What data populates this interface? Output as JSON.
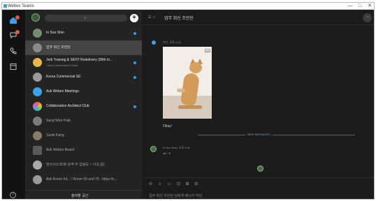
{
  "window": {
    "title": "Webex Teams",
    "controls": [
      "—",
      "□",
      "✕"
    ]
  },
  "rail": {
    "icons": [
      "home-icon",
      "message-icon",
      "phone-icon",
      "calendar-icon"
    ],
    "help_glyph": "?"
  },
  "search": {
    "icon_glyph": "⌕",
    "add_glyph": "+"
  },
  "spaces": [
    {
      "name": "In Soo Shin",
      "sub": "",
      "unread": true,
      "color": "#6f8f6a"
    },
    {
      "name": "업무 회신 조언단",
      "sub": "",
      "unread": false,
      "color": "#8a8a8a"
    },
    {
      "name": "Jedi Training & SENT Redelivery (99th In...",
      "sub": "Cisco Collaboration Team",
      "unread": true,
      "color": "#e8b84a"
    },
    {
      "name": "Korea Commercial SE",
      "sub": "",
      "unread": true,
      "color": "#9a9a9a"
    },
    {
      "name": "Ask Webex Meetings",
      "sub": "",
      "unread": false,
      "color": "#3aa2e8"
    },
    {
      "name": "Collaboration Architect Club",
      "sub": "",
      "unread": true,
      "color": "#d06cc8"
    },
    {
      "name": "Sang Woo Park",
      "sub": "",
      "unread": false,
      "color": "#7a7a7a"
    },
    {
      "name": "Sunki Kang",
      "sub": "",
      "unread": false,
      "color": "#8a7a6a"
    },
    {
      "name": "Ask Webex Board",
      "sub": "",
      "unread": false,
      "color": "#5a5a5a"
    },
    {
      "name": "한국시스코(로 원격 수 업용도 ~ 사고,감)",
      "sub": "",
      "unread": false,
      "color": "#aaaaaa"
    },
    {
      "name": "Ask Room Kit... / Room 55 and 70 - https://c...",
      "sub": "",
      "unread": false,
      "color": "#9a9a9a"
    }
  ],
  "list_footer": {
    "label": "참여할 공간"
  },
  "chat": {
    "header_icons": "☰ ◁",
    "title": "업무 회신 조언단",
    "more_glyph": "⋯",
    "message1": {
      "time": "본인, 오후 4:40",
      "gif_label": "GIF",
      "text": "Okay!"
    },
    "new_messages_label": "NEW MESSAGES",
    "message2": {
      "meta": "In Soo Shin, 오후 4:41",
      "text": "ok~~!!"
    },
    "composer_toolbar": "⊘ ☺ ▭ ⊡ ⊞ ⊟",
    "composer_placeholder": "업무 회신 조언단 님에게 메시지 작성"
  },
  "colors": {
    "accent": "#3aa2e8",
    "unread_dot": "#3aa2e8",
    "badge": "#e0564a"
  }
}
